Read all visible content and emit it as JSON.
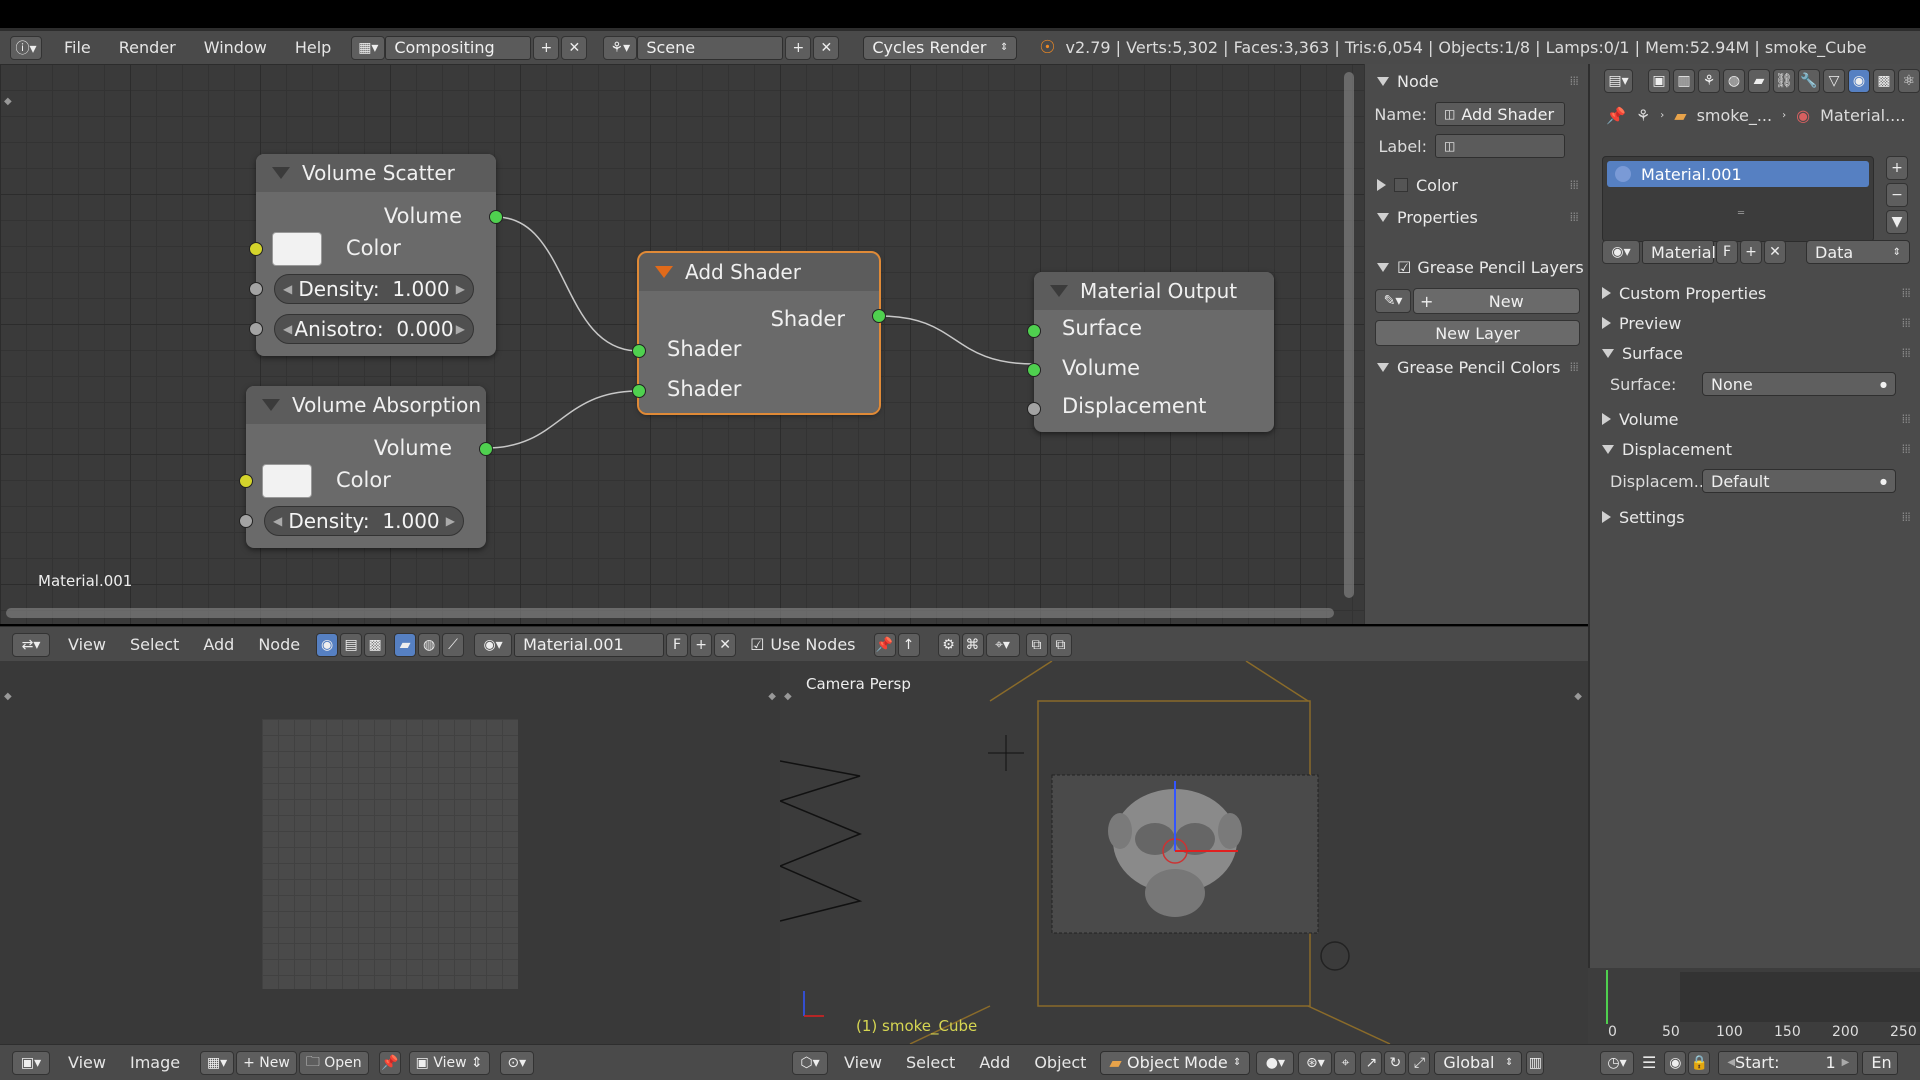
{
  "topbar": {
    "menus": [
      "File",
      "Render",
      "Window",
      "Help"
    ],
    "layout": "Compositing",
    "scene": "Scene",
    "engine": "Cycles Render",
    "stats": "v2.79 | Verts:5,302 | Faces:3,363 | Tris:6,054 | Objects:1/8 | Lamps:0/1 | Mem:52.94M | smoke_Cube"
  },
  "node_editor": {
    "material_label": "Material.001",
    "nodes": {
      "volume_scatter": {
        "title": "Volume Scatter",
        "output": "Volume",
        "color_label": "Color",
        "density_label": "Density:",
        "density_value": "1.000",
        "aniso_label": "Anisotro:",
        "aniso_value": "0.000"
      },
      "volume_absorption": {
        "title": "Volume Absorption",
        "output": "Volume",
        "color_label": "Color",
        "density_label": "Density:",
        "density_value": "1.000"
      },
      "add_shader": {
        "title": "Add Shader",
        "output": "Shader",
        "input1": "Shader",
        "input2": "Shader"
      },
      "material_output": {
        "title": "Material Output",
        "surface": "Surface",
        "volume": "Volume",
        "displacement": "Displacement"
      }
    }
  },
  "side_panel": {
    "node_header": "Node",
    "name_label": "Name:",
    "name_value": "Add Shader",
    "label_label": "Label:",
    "color": "Color",
    "properties": "Properties",
    "grease_layers": "Grease Pencil Layers",
    "new_button": "New",
    "new_layer_button": "New Layer",
    "grease_colors": "Grease Pencil Colors"
  },
  "props": {
    "breadcrumb_object": "smoke_...",
    "breadcrumb_material": "Material....",
    "slot_name": "Material.001",
    "material_field": "Material.",
    "f_label": "F",
    "data_dropdown": "Data",
    "sections": {
      "custom": "Custom Properties",
      "preview": "Preview",
      "surface": "Surface",
      "surface_label": "Surface:",
      "surface_value": "None",
      "volume": "Volume",
      "displacement": "Displacement",
      "disp_label": "Displacem...",
      "disp_value": "Default",
      "settings": "Settings"
    }
  },
  "node_header_bar": {
    "menus": [
      "View",
      "Select",
      "Add",
      "Node"
    ],
    "material": "Material.001",
    "f_label": "F",
    "use_nodes": "Use Nodes"
  },
  "image_editor_bar": {
    "menus": [
      "View",
      "Image"
    ],
    "new_label": "New",
    "open_label": "Open",
    "view_label": "View"
  },
  "viewport": {
    "label": "Camera Persp",
    "object_label": "(1) smoke_Cube"
  },
  "viewport_bar": {
    "menus": [
      "View",
      "Select",
      "Add",
      "Object"
    ],
    "mode": "Object Mode",
    "orientation": "Global"
  },
  "timeline": {
    "ticks": [
      "0",
      "50",
      "100",
      "150",
      "200",
      "250"
    ],
    "start_label": "Start:",
    "start_value": "1",
    "end_label": "En"
  },
  "colors": {
    "socket_shader": "#4fd04f",
    "socket_color": "#d4d42b",
    "socket_value": "#a3a3a3",
    "active_node_outline": "#e08a37",
    "selected_slot": "#5680c2"
  }
}
